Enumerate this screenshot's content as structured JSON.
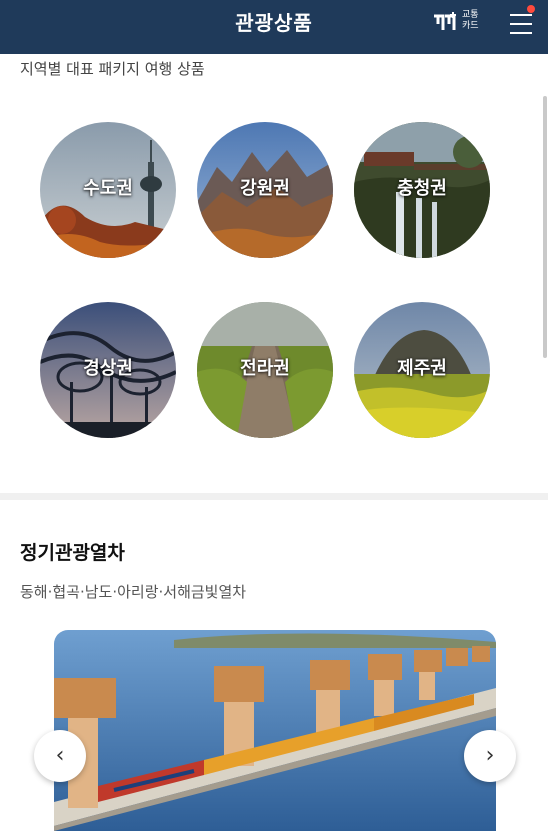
{
  "header": {
    "title": "관광상품",
    "card_label_line1": "교통",
    "card_label_line2": "카드"
  },
  "regions_section": {
    "subtitle": "지역별 대표 패키지 여행 상품",
    "regions": [
      {
        "name": "수도권"
      },
      {
        "name": "강원권"
      },
      {
        "name": "충청권"
      },
      {
        "name": "경상권"
      },
      {
        "name": "전라권"
      },
      {
        "name": "제주권"
      }
    ]
  },
  "train_section": {
    "title": "정기관광열차",
    "subtitle": "동해·협곡·남도·아리랑·서해금빛열차",
    "prev_icon": "‹",
    "next_icon": "›"
  }
}
